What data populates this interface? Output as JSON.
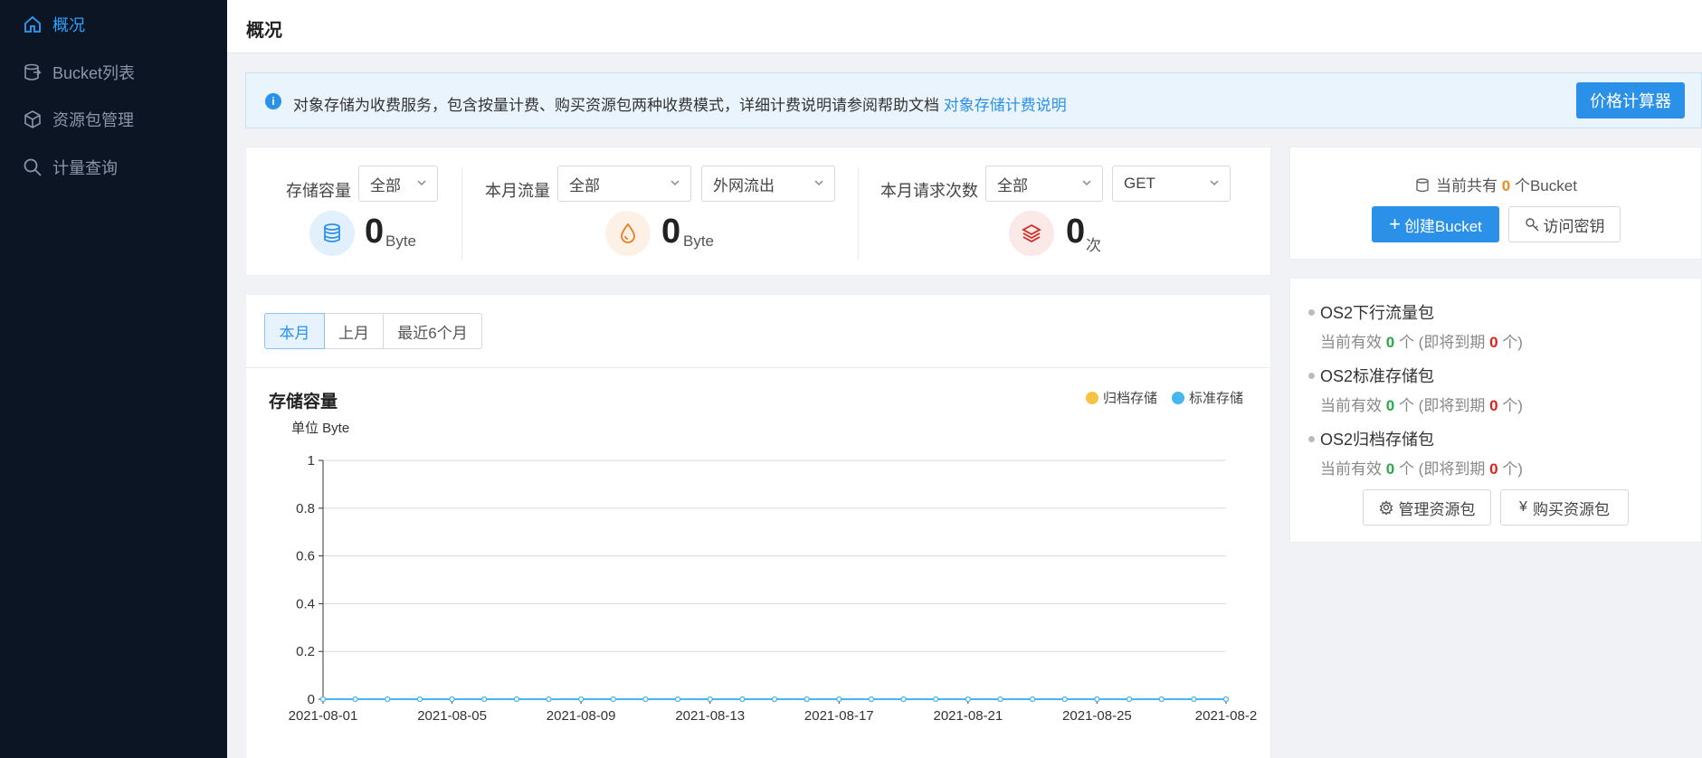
{
  "sidebar": {
    "items": [
      {
        "label": "概况",
        "icon": "home-icon",
        "active": true
      },
      {
        "label": "Bucket列表",
        "icon": "bucket-icon",
        "active": false
      },
      {
        "label": "资源包管理",
        "icon": "package-icon",
        "active": false
      },
      {
        "label": "计量查询",
        "icon": "search-icon",
        "active": false
      }
    ]
  },
  "header": {
    "title": "概况"
  },
  "notice": {
    "text": "对象存储为收费服务，包含按量计费、购买资源包两种收费模式，详细计费说明请参阅帮助文档",
    "link": "对象存储计费说明",
    "button": "价格计算器"
  },
  "stats": {
    "storage": {
      "label": "存储容量",
      "select": "全部",
      "value": "0",
      "unit": "Byte"
    },
    "traffic": {
      "label": "本月流量",
      "select1": "全部",
      "select2": "外网流出",
      "value": "0",
      "unit": "Byte"
    },
    "requests": {
      "label": "本月请求次数",
      "select1": "全部",
      "select2": "GET",
      "value": "0",
      "unit": "次"
    }
  },
  "bucket": {
    "prefix": "当前共有",
    "count": "0",
    "suffix": "个Bucket",
    "create_label": "创建Bucket",
    "key_label": "访问密钥"
  },
  "packages": {
    "items": [
      {
        "title": "OS2下行流量包",
        "valid_prefix": "当前有效",
        "valid": "0",
        "mid": "个 (即将到期",
        "expiring": "0",
        "end": "个)"
      },
      {
        "title": "OS2标准存储包",
        "valid_prefix": "当前有效",
        "valid": "0",
        "mid": "个 (即将到期",
        "expiring": "0",
        "end": "个)"
      },
      {
        "title": "OS2归档存储包",
        "valid_prefix": "当前有效",
        "valid": "0",
        "mid": "个 (即将到期",
        "expiring": "0",
        "end": "个)"
      }
    ],
    "manage_label": "管理资源包",
    "buy_label": "购买资源包"
  },
  "chart": {
    "tabs": [
      "本月",
      "上月",
      "最近6个月"
    ],
    "active_tab": 0
  },
  "colors": {
    "accent": "#2b91e8",
    "archive_series": "#f6c343",
    "standard_series": "#45b6ef"
  },
  "chart_data": {
    "type": "line",
    "title": "存储容量",
    "unit_label": "单位 Byte",
    "ylim": [
      0,
      1
    ],
    "yticks": [
      "0",
      "0.2",
      "0.4",
      "0.6",
      "0.8",
      "1"
    ],
    "xtick_labels": [
      "2021-08-01",
      "2021-08-05",
      "2021-08-09",
      "2021-08-13",
      "2021-08-17",
      "2021-08-21",
      "2021-08-25",
      "2021-08-2"
    ],
    "x": [
      "2021-08-01",
      "2021-08-02",
      "2021-08-03",
      "2021-08-04",
      "2021-08-05",
      "2021-08-06",
      "2021-08-07",
      "2021-08-08",
      "2021-08-09",
      "2021-08-10",
      "2021-08-11",
      "2021-08-12",
      "2021-08-13",
      "2021-08-14",
      "2021-08-15",
      "2021-08-16",
      "2021-08-17",
      "2021-08-18",
      "2021-08-19",
      "2021-08-20",
      "2021-08-21",
      "2021-08-22",
      "2021-08-23",
      "2021-08-24",
      "2021-08-25",
      "2021-08-26",
      "2021-08-27",
      "2021-08-28",
      "2021-08-29"
    ],
    "series": [
      {
        "name": "归档存储",
        "values": [
          0,
          0,
          0,
          0,
          0,
          0,
          0,
          0,
          0,
          0,
          0,
          0,
          0,
          0,
          0,
          0,
          0,
          0,
          0,
          0,
          0,
          0,
          0,
          0,
          0,
          0,
          0,
          0,
          0
        ]
      },
      {
        "name": "标准存储",
        "values": [
          0,
          0,
          0,
          0,
          0,
          0,
          0,
          0,
          0,
          0,
          0,
          0,
          0,
          0,
          0,
          0,
          0,
          0,
          0,
          0,
          0,
          0,
          0,
          0,
          0,
          0,
          0,
          0,
          0
        ]
      }
    ],
    "grid": true,
    "legend": "top-right"
  }
}
